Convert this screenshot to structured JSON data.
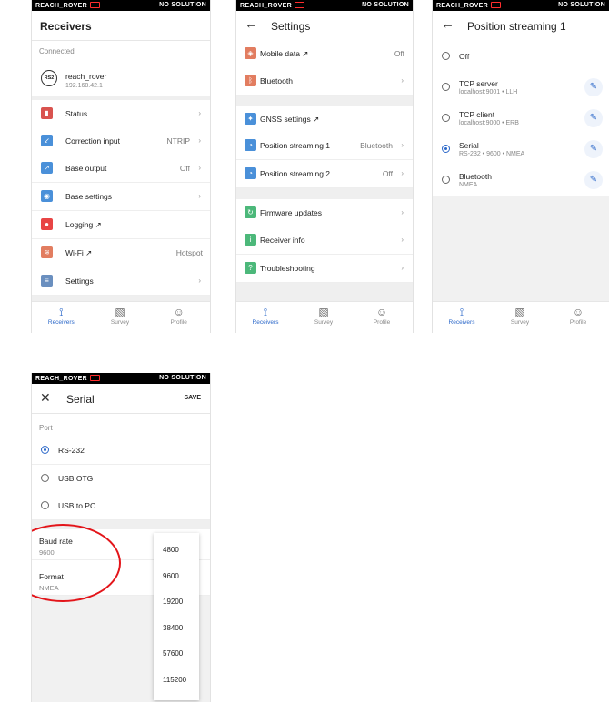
{
  "statusbar": {
    "device": "REACH_ROVER",
    "solution": "NO SOLUTION"
  },
  "screen1": {
    "title": "Receivers",
    "section": "Connected",
    "receiver": {
      "badge": "RS2",
      "name": "reach_rover",
      "ip": "192.168.42.1"
    },
    "items": [
      {
        "label": "Status",
        "value": "",
        "icon": "status-icon",
        "color": "#d9534f"
      },
      {
        "label": "Correction input",
        "value": "NTRIP",
        "icon": "correction-input-icon",
        "color": "#4a90d9"
      },
      {
        "label": "Base output",
        "value": "Off",
        "icon": "base-output-icon",
        "color": "#4a90d9"
      },
      {
        "label": "Base settings",
        "value": "",
        "icon": "base-settings-icon",
        "color": "#4a90d9"
      },
      {
        "label": "Logging ↗",
        "value": "",
        "icon": "logging-icon",
        "color": "#e84545"
      },
      {
        "label": "Wi-Fi ↗",
        "value": "Hotspot",
        "icon": "wifi-icon",
        "color": "#e27d60"
      },
      {
        "label": "Settings",
        "value": "",
        "icon": "settings-icon",
        "color": "#6a8fbf"
      }
    ]
  },
  "screen2": {
    "title": "Settings",
    "items": [
      {
        "label": "Mobile data ↗",
        "value": "Off",
        "icon": "mobile-data-icon",
        "color": "#e27d60"
      },
      {
        "label": "Bluetooth",
        "value": "",
        "icon": "bluetooth-icon",
        "color": "#e27d60"
      },
      {
        "label": "GNSS settings ↗",
        "value": "",
        "icon": "gnss-icon",
        "color": "#4a90d9"
      },
      {
        "label": "Position streaming 1",
        "value": "Bluetooth",
        "icon": "position-streaming-icon",
        "color": "#4a90d9"
      },
      {
        "label": "Position streaming 2",
        "value": "Off",
        "icon": "position-streaming-icon",
        "color": "#4a90d9"
      },
      {
        "label": "Firmware updates",
        "value": "",
        "icon": "firmware-icon",
        "color": "#4cb87a"
      },
      {
        "label": "Receiver info",
        "value": "",
        "icon": "info-icon",
        "color": "#4cb87a"
      },
      {
        "label": "Troubleshooting",
        "value": "",
        "icon": "help-icon",
        "color": "#4cb87a"
      }
    ]
  },
  "screen3": {
    "title": "Position streaming 1",
    "options": [
      {
        "label": "Off",
        "sub": "",
        "selected": false,
        "editable": false
      },
      {
        "label": "TCP server",
        "sub": "localhost:9001 • LLH",
        "selected": false,
        "editable": true
      },
      {
        "label": "TCP client",
        "sub": "localhost:9000 • ERB",
        "selected": false,
        "editable": true
      },
      {
        "label": "Serial",
        "sub": "RS-232 • 9600 • NMEA",
        "selected": true,
        "editable": true
      },
      {
        "label": "Bluetooth",
        "sub": "NMEA",
        "selected": false,
        "editable": true
      }
    ]
  },
  "screen4": {
    "title": "Serial",
    "save": "SAVE",
    "section": "Port",
    "ports": [
      {
        "label": "RS-232",
        "selected": true
      },
      {
        "label": "USB OTG",
        "selected": false
      },
      {
        "label": "USB to PC",
        "selected": false
      }
    ],
    "baud_label": "Baud rate",
    "baud_value": "9600",
    "format_label": "Format",
    "format_value": "NMEA",
    "baud_options": [
      "4800",
      "9600",
      "19200",
      "38400",
      "57600",
      "115200"
    ]
  },
  "tabs": [
    {
      "label": "Receivers",
      "icon": "receivers-icon"
    },
    {
      "label": "Survey",
      "icon": "survey-icon"
    },
    {
      "label": "Profile",
      "icon": "profile-icon"
    }
  ],
  "accent_color": "#2a67c9",
  "highlight_color": "#e3151a"
}
